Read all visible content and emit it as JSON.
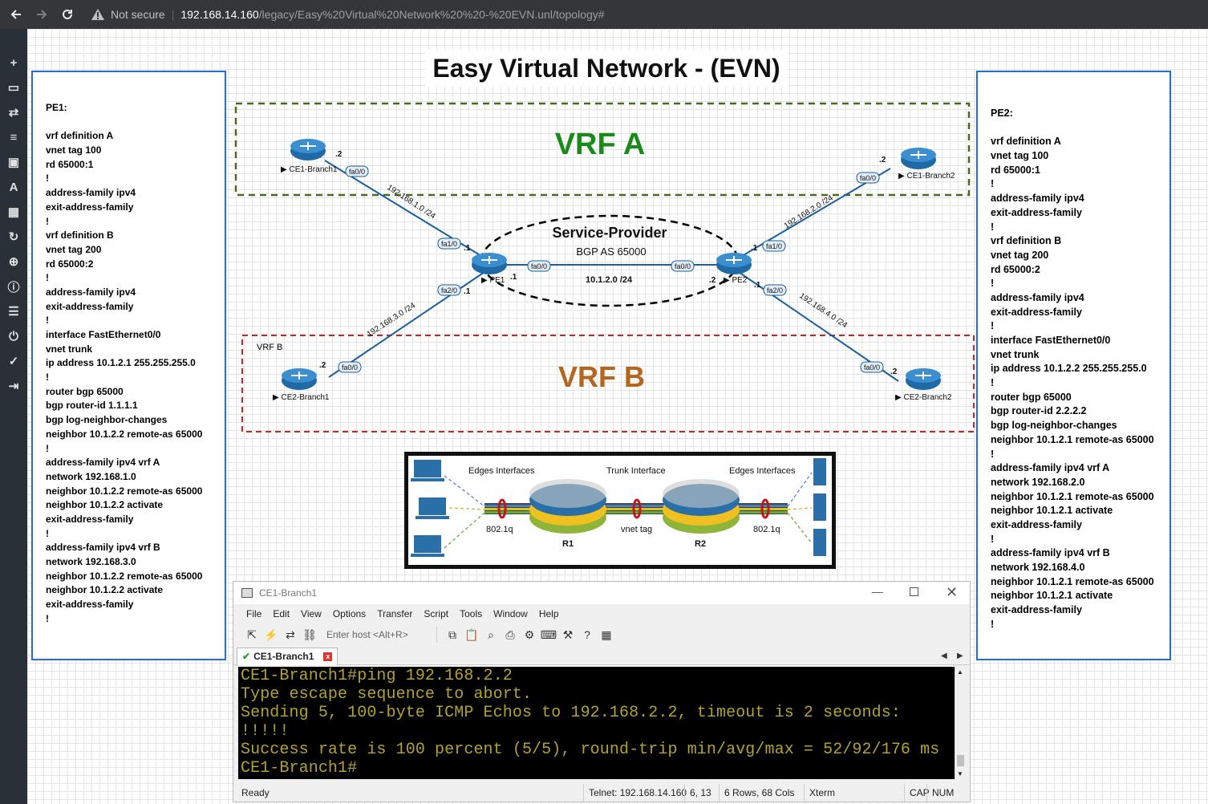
{
  "browser": {
    "security_label": "Not secure",
    "host": "192.168.14.160",
    "path": "/legacy/Easy%20Virtual%20Network%20%20-%20EVN.unl/topology#"
  },
  "sidebar": {
    "icons": [
      "add-icon",
      "storage-icon",
      "transfer-icon",
      "align-icon",
      "image-icon",
      "text-icon",
      "grid-icon",
      "refresh-icon",
      "zoom-icon",
      "info-icon",
      "list-icon",
      "power-icon",
      "check-icon",
      "logout-icon"
    ]
  },
  "topology": {
    "title": "Easy Virtual Network - (EVN)",
    "vrf_a_label": "VRF A",
    "vrf_b_label": "VRF B",
    "vrf_b_small": "VRF B",
    "sp_title": "Service-Provider",
    "sp_sub": "BGP AS 65000",
    "colors": {
      "vrf_a": "#1a8a1a",
      "vrf_b": "#b5651d",
      "link": "#1a5fa0",
      "border": "#1f6fd1"
    },
    "nodes": {
      "ce1_b1": "CE1-Branch1",
      "ce1_b2": "CE1-Branch2",
      "ce2_b1": "CE2-Branch1",
      "ce2_b2": "CE2-Branch2",
      "pe1": "PE1",
      "pe2": "PE2"
    },
    "ifaces": {
      "fa00": "fa0/0",
      "fa10": "fa1/0",
      "fa20": "fa2/0"
    },
    "subnets": {
      "a1": "192.168.1.0 /24",
      "a2": "192.168.2.0 /24",
      "b1": "192.168.3.0 /24",
      "b2": "192.168.4.0 /24",
      "core": "10.1.2.0 /24"
    },
    "hosts": {
      "dot1": ".1",
      "dot2": ".2"
    }
  },
  "evn_image": {
    "edges_left": "Edges Interfaces",
    "trunk": "Trunk Interface",
    "edges_right": "Edges Interfaces",
    "dot1q_left": "802.1q",
    "vnet_tag": "vnet tag",
    "dot1q_right": "802.1q",
    "r1": "R1",
    "r2": "R2"
  },
  "pe1_config": [
    "PE1:",
    "",
    "vrf definition A",
    "vnet tag 100",
    "rd 65000:1",
    "!",
    "address-family ipv4",
    "exit-address-family",
    "!",
    "vrf definition B",
    "vnet tag 200",
    "rd 65000:2",
    "!",
    "address-family ipv4",
    "exit-address-family",
    "!",
    "interface FastEthernet0/0",
    "vnet trunk",
    "ip address 10.1.2.1 255.255.255.0",
    "!",
    "router bgp 65000",
    "bgp router-id 1.1.1.1",
    "bgp log-neighbor-changes",
    "neighbor 10.1.2.2 remote-as 65000",
    "!",
    "address-family ipv4 vrf A",
    "network 192.168.1.0",
    "neighbor 10.1.2.2 remote-as 65000",
    "neighbor 10.1.2.2 activate",
    "exit-address-family",
    "!",
    "address-family ipv4 vrf B",
    "network 192.168.3.0",
    "neighbor 10.1.2.2 remote-as 65000",
    "neighbor 10.1.2.2 activate",
    "exit-address-family",
    "!"
  ],
  "pe2_config": [
    "PE2:",
    "",
    "vrf definition A",
    "vnet tag 100",
    "rd 65000:1",
    "!",
    "address-family ipv4",
    "exit-address-family",
    "!",
    "vrf definition B",
    "vnet tag 200",
    "rd 65000:2",
    "!",
    "address-family ipv4",
    "exit-address-family",
    "!",
    "interface FastEthernet0/0",
    "vnet trunk",
    "ip address 10.1.2.2 255.255.255.0",
    "!",
    "router bgp 65000",
    "bgp router-id 2.2.2.2",
    "bgp log-neighbor-changes",
    "neighbor 10.1.2.1 remote-as 65000",
    "!",
    "address-family ipv4 vrf A",
    "network 192.168.2.0",
    "neighbor 10.1.2.1 remote-as 65000",
    "neighbor 10.1.2.1 activate",
    "exit-address-family",
    "!",
    "address-family ipv4 vrf B",
    "network 192.168.4.0",
    "neighbor 10.1.2.1 remote-as 65000",
    "neighbor 10.1.2.1 activate",
    "exit-address-family",
    "!"
  ],
  "terminal": {
    "window_title": "CE1-Branch1",
    "menu": [
      "File",
      "Edit",
      "View",
      "Options",
      "Transfer",
      "Script",
      "Tools",
      "Window",
      "Help"
    ],
    "host_placeholder": "Enter host <Alt+R>",
    "tab_label": "CE1-Branch1",
    "lines": [
      "CE1-Branch1#ping 192.168.2.2",
      "Type escape sequence to abort.",
      "Sending 5, 100-byte ICMP Echos to 192.168.2.2, timeout is 2 seconds:",
      "!!!!!",
      "Success rate is 100 percent (5/5), round-trip min/avg/max = 52/92/176 ms",
      "CE1-Branch1#"
    ],
    "status": {
      "ready": "Ready",
      "telnet": "Telnet: 192.168.14.160",
      "cursor": "6,  13",
      "size": "6 Rows, 68 Cols",
      "term": "Xterm",
      "cap": "CAP",
      "num": "NUM"
    }
  }
}
